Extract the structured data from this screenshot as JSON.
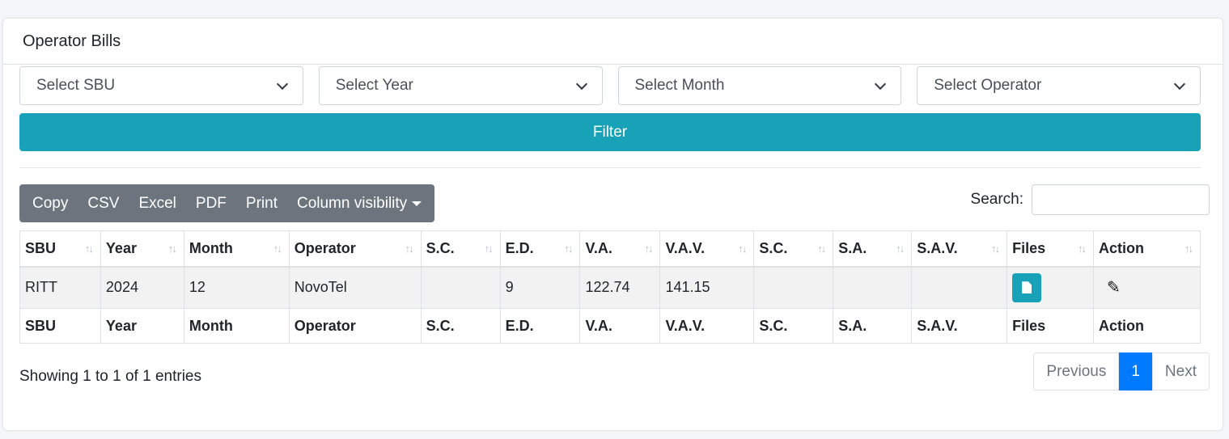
{
  "card": {
    "title": "Operator Bills"
  },
  "filters": {
    "sbu": "Select SBU",
    "year": "Select Year",
    "month": "Select Month",
    "operator": "Select Operator",
    "button": "Filter"
  },
  "toolbar": {
    "copy": "Copy",
    "csv": "CSV",
    "excel": "Excel",
    "pdf": "PDF",
    "print": "Print",
    "column_visibility": "Column visibility"
  },
  "search": {
    "label": "Search:",
    "value": ""
  },
  "table": {
    "headers": [
      "SBU",
      "Year",
      "Month",
      "Operator",
      "S.C.",
      "E.D.",
      "V.A.",
      "V.A.V.",
      "S.C.",
      "S.A.",
      "S.A.V.",
      "Files",
      "Action"
    ],
    "rows": [
      [
        "RITT",
        "2024",
        "12",
        "NovoTel",
        "",
        "9",
        "122.74",
        "141.15",
        "",
        "",
        ""
      ]
    ],
    "row_icons": {
      "files": "file-icon",
      "action": "edit-icon"
    }
  },
  "footer": {
    "info": "Showing 1 to 1 of 1 entries",
    "prev": "Previous",
    "page": "1",
    "next": "Next"
  },
  "colors": {
    "accent": "#17a2b8",
    "primary": "#007bff",
    "toolbar": "#6c757d"
  }
}
